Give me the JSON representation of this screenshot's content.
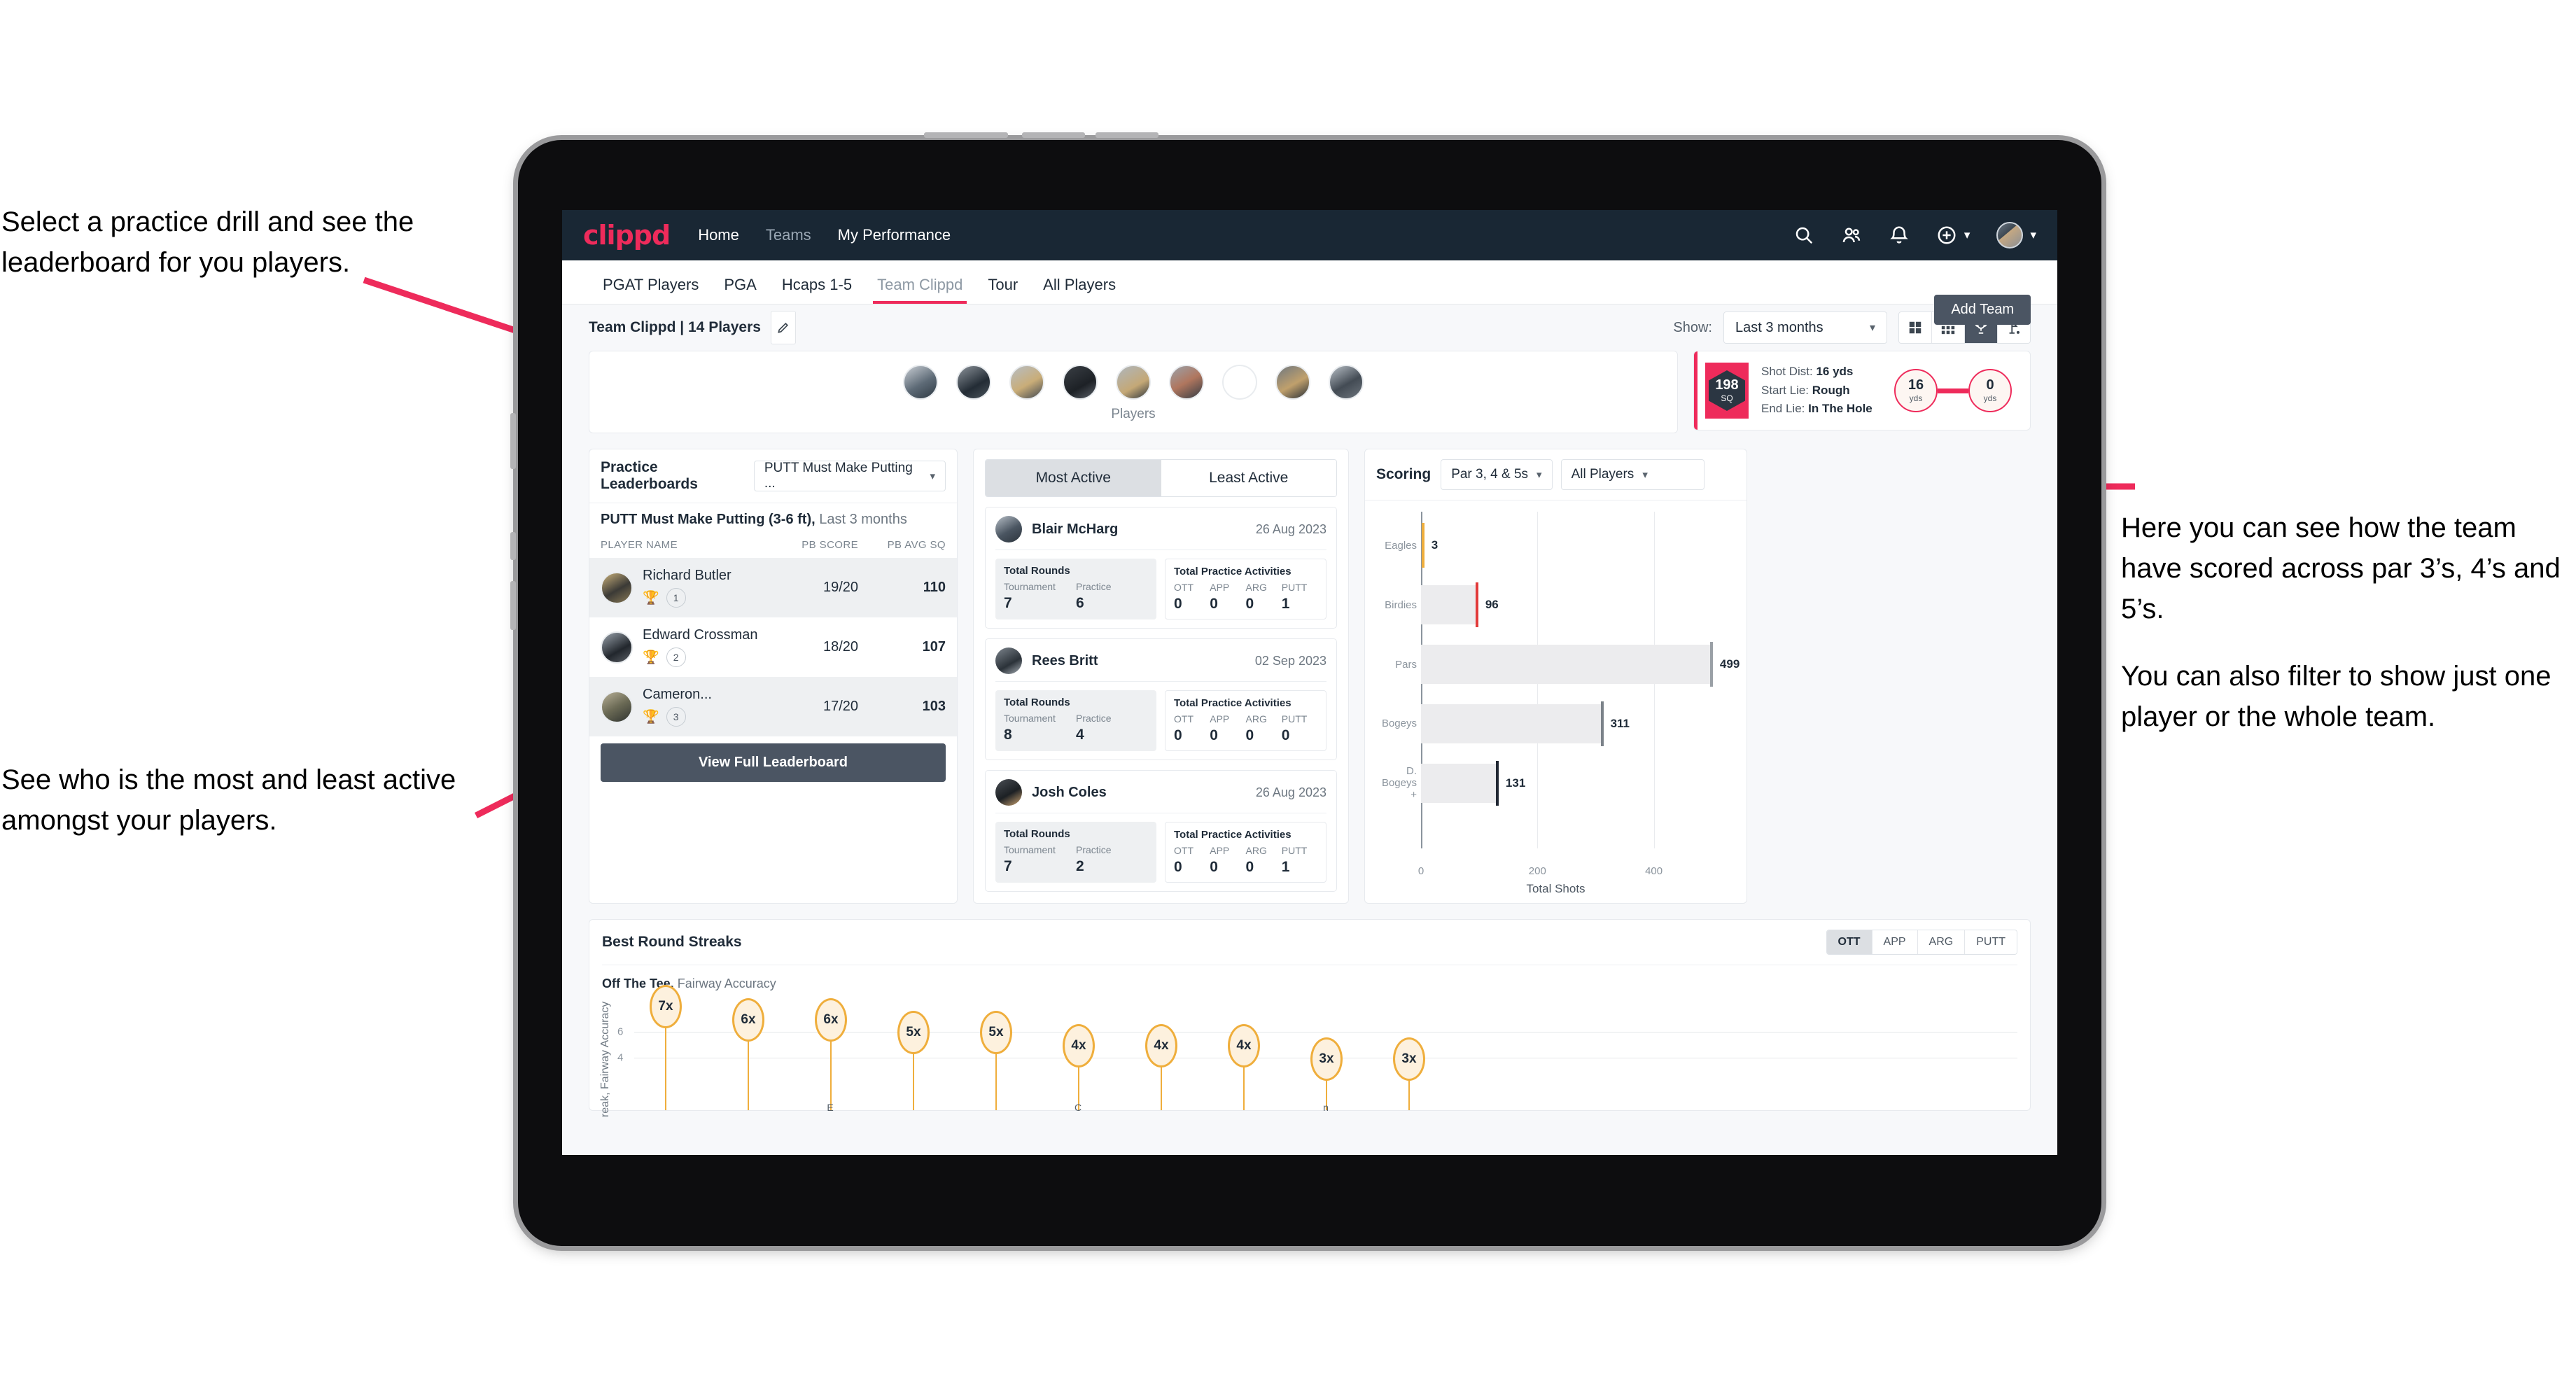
{
  "annotations": {
    "left_top": "Select a practice drill and see the leaderboard for you players.",
    "left_bottom": "See who is the most and least active amongst your players.",
    "right_1": "Here you can see how the team have scored across par 3’s, 4’s and 5’s.",
    "right_2": "You can also filter to show just one player or the whole team."
  },
  "topnav": {
    "logo": "clippd",
    "links": [
      {
        "label": "Home",
        "active": true
      },
      {
        "label": "Teams",
        "active": false
      },
      {
        "label": "My Performance",
        "active": true
      }
    ],
    "icons": [
      "search-icon",
      "people-icon",
      "bell-icon",
      "plus-circle-icon",
      "avatar"
    ]
  },
  "tabs": [
    {
      "label": "PGAT Players",
      "active": false
    },
    {
      "label": "PGA",
      "active": false
    },
    {
      "label": "Hcaps 1-5",
      "active": false
    },
    {
      "label": "Team Clippd",
      "active": true
    },
    {
      "label": "Tour",
      "active": false
    },
    {
      "label": "All Players",
      "active": false
    }
  ],
  "add_team_button": "Add Team",
  "toolbar": {
    "team_title": "Team Clippd | 14 Players",
    "edit_icon": "pencil-icon",
    "show_label": "Show:",
    "period_value": "Last 3 months",
    "view_buttons": [
      "grid-4-icon",
      "grid-9-icon",
      "trophy-icon",
      "flag-icon"
    ],
    "active_view": "trophy-icon"
  },
  "players_strip": {
    "label": "Players",
    "count": 9
  },
  "shot_card": {
    "sq_value": "198",
    "sq_unit": "SQ",
    "rows": [
      {
        "k": "Shot Dist:",
        "v": "16 yds"
      },
      {
        "k": "Start Lie:",
        "v": "Rough"
      },
      {
        "k": "End Lie:",
        "v": "In The Hole"
      }
    ],
    "start_yards": "16",
    "start_unit": "yds",
    "end_yards": "0",
    "end_unit": "yds"
  },
  "leaderboard": {
    "title": "Practice Leaderboards",
    "drill_select": "PUTT Must Make Putting ...",
    "subtitle_bold": "PUTT Must Make Putting (3-6 ft),",
    "subtitle_muted": "Last 3 months",
    "columns": [
      "PLAYER NAME",
      "PB SCORE",
      "PB AVG SQ"
    ],
    "rows": [
      {
        "name": "Richard Butler",
        "rank": "1",
        "score": "19/20",
        "avg": "110"
      },
      {
        "name": "Edward Crossman",
        "rank": "2",
        "score": "18/20",
        "avg": "107"
      },
      {
        "name": "Cameron...",
        "rank": "3",
        "score": "17/20",
        "avg": "103"
      }
    ],
    "view_full": "View Full Leaderboard"
  },
  "activity": {
    "tabs": [
      {
        "label": "Most Active",
        "active": true
      },
      {
        "label": "Least Active",
        "active": false
      }
    ],
    "rounds_title": "Total Rounds",
    "acts_title": "Total Practice Activities",
    "rounds_cols": [
      "Tournament",
      "Practice"
    ],
    "acts_cols": [
      "OTT",
      "APP",
      "ARG",
      "PUTT"
    ],
    "players": [
      {
        "name": "Blair McHarg",
        "date": "26 Aug 2023",
        "tournament": "7",
        "practice": "6",
        "ott": "0",
        "app": "0",
        "arg": "0",
        "putt": "1"
      },
      {
        "name": "Rees Britt",
        "date": "02 Sep 2023",
        "tournament": "8",
        "practice": "4",
        "ott": "0",
        "app": "0",
        "arg": "0",
        "putt": "0"
      },
      {
        "name": "Josh Coles",
        "date": "26 Aug 2023",
        "tournament": "7",
        "practice": "2",
        "ott": "0",
        "app": "0",
        "arg": "0",
        "putt": "1"
      }
    ]
  },
  "scoring": {
    "title": "Scoring",
    "par_select": "Par 3, 4 & 5s",
    "player_select": "All Players"
  },
  "streaks": {
    "title": "Best Round Streaks",
    "segments": [
      {
        "label": "OTT",
        "active": true
      },
      {
        "label": "APP",
        "active": false
      },
      {
        "label": "ARG",
        "active": false
      },
      {
        "label": "PUTT",
        "active": false
      }
    ],
    "caption_bold": "Off The Tee,",
    "caption_muted": "Fairway Accuracy"
  },
  "chart_data": [
    {
      "type": "bar",
      "orientation": "horizontal",
      "title": "Scoring",
      "categories": [
        "Eagles",
        "Birdies",
        "Pars",
        "Bogeys",
        "D. Bogeys +"
      ],
      "values": [
        3,
        96,
        499,
        311,
        131
      ],
      "cap_colors": [
        "#efae3c",
        "#e23b3b",
        "#9aa0a6",
        "#7b8289",
        "#202733"
      ],
      "xlabel": "Total Shots",
      "ylabel": "",
      "xticks": [
        0,
        200,
        400
      ],
      "xlim": [
        0,
        540
      ],
      "grid": true
    },
    {
      "type": "bar",
      "orientation": "vertical",
      "title": "Best Round Streaks",
      "subtitle": "Off The Tee, Fairway Accuracy",
      "categories": [
        "",
        "",
        "E",
        "",
        "",
        "C",
        "",
        "",
        "n",
        "",
        ""
      ],
      "values": [
        7,
        6,
        6,
        5,
        5,
        4,
        4,
        4,
        3,
        3
      ],
      "labels": [
        "7x",
        "6x",
        "6x",
        "5x",
        "5x",
        "4x",
        "4x",
        "4x",
        "3x",
        "3x"
      ],
      "ylabel": "reak, Fairway Accuracy",
      "yticks": [
        4,
        6
      ],
      "ylim": [
        0,
        8
      ],
      "grid": true,
      "marker_color": "#efae3c",
      "marker_fill": "#fdf1de"
    }
  ]
}
